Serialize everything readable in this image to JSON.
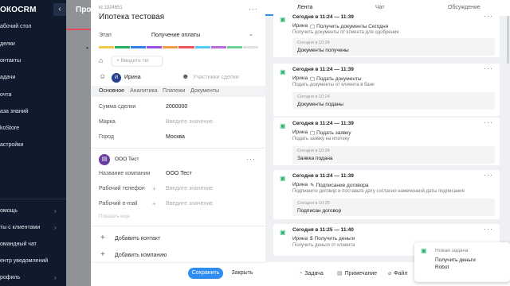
{
  "nav": {
    "logo": "ОКОCRM",
    "items": [
      "абочий стол",
      "делки",
      "онтакты",
      "адачи",
      "очта",
      "аза знаний",
      "koStore",
      "астройки"
    ],
    "bottom_items": [
      "омощь",
      "ты с клиентами",
      "омандный чат",
      "ентр уведомлений",
      "рофиль"
    ]
  },
  "bg_page": {
    "title": "Про"
  },
  "deal": {
    "id": "id 1924651",
    "title": "Ипотека тестовая",
    "stage_label": "Этап",
    "stage_value": "Получение оплаты",
    "stage_colors": [
      "#f2c94c",
      "#27ae60",
      "#2f80ed",
      "#9b51e0",
      "#f2994a",
      "#eb5757",
      "#56ccf2",
      "#bb6bd9",
      "#6fcf97",
      "#e0e0e0"
    ],
    "tag_placeholder": "+ Введите тег",
    "responsible": "Ирина",
    "participants": "Участники сделки",
    "tabs": [
      "Основное",
      "Аналитика",
      "Платежи",
      "Документы"
    ],
    "fields": [
      {
        "label": "Сумма сделки",
        "value": "2000000"
      },
      {
        "label": "Марка",
        "value": "Введите значение"
      },
      {
        "label": "Город",
        "value": "Москва"
      }
    ],
    "company": {
      "name": "ООО Тест",
      "fields": [
        {
          "label": "Название компании",
          "value": "ООО Тест"
        },
        {
          "label": "Рабочий телефон",
          "value": "Введите значение"
        },
        {
          "label": "Рабочий e-mail",
          "value": "Введите значение"
        }
      ],
      "show_more": "Показать еще"
    },
    "add_contact": "Добавить контакт",
    "add_company": "Добавить компанию",
    "save": "Сохранить",
    "close": "Закрыть"
  },
  "feed": {
    "tabs": [
      "Лента",
      "Чат",
      "Обсуждение"
    ],
    "items": [
      {
        "when": "Сегодня в 11:24 — 11:39",
        "who": "Ирина",
        "type": "Получить документы",
        "extra": "Сегодня",
        "desc": "Получить документы от клиента для одобрения",
        "rtime": "Сегодня в 10:24",
        "rtext": "Документы получены"
      },
      {
        "when": "Сегодня в 11:24 — 11:39",
        "who": "Ирина",
        "type": "Подать документы",
        "extra": "",
        "desc": "Подать документы от клиента в банк",
        "rtime": "Сегодня в 10:24",
        "rtext": "Документы поданы"
      },
      {
        "when": "Сегодня в 11:24 — 11:39",
        "who": "Ирина",
        "type": "Подать заявку",
        "extra": "",
        "desc": "Подать заявку на ипотеку",
        "rtime": "Сегодня в 10:24",
        "rtext": "Заявка подана"
      },
      {
        "when": "Сегодня в 11:24 — 11:39",
        "who": "Ирина",
        "type": "Подписание договора",
        "extra": "",
        "desc": "Подпишите договор и поставьте дату согласно намеченной даты подписания",
        "rtime": "Сегодня в 10:25",
        "rtext": "Подписан договор"
      },
      {
        "when": "Сегодня в 11:25 — 11:40",
        "who": "Ирина",
        "type": "Получить деньги",
        "extra": "",
        "desc": "Получить деньги от клиента",
        "rtime": "",
        "rtext": ""
      }
    ],
    "bottom": [
      "Задача",
      "Примечание",
      "Файл"
    ],
    "notification": {
      "title": "Новая задача",
      "text": "Получить деньги",
      "author": "Robot"
    }
  }
}
